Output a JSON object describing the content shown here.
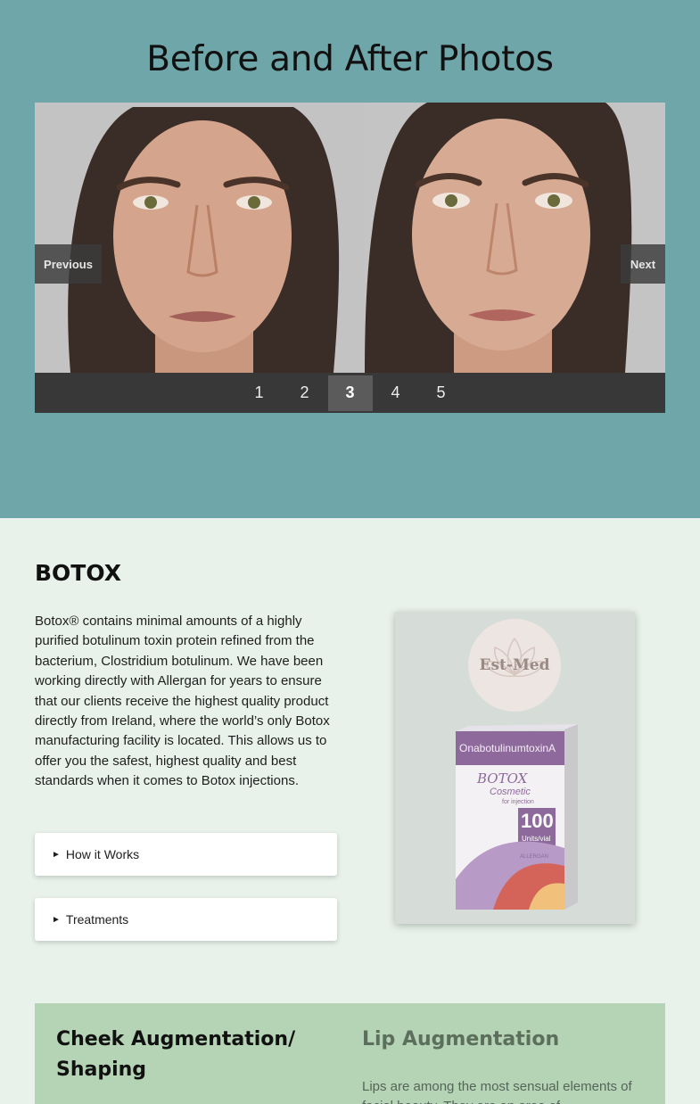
{
  "gallery": {
    "title": "Before and After Photos",
    "prev_label": "Previous",
    "next_label": "Next",
    "pages": [
      "1",
      "2",
      "3",
      "4",
      "5"
    ],
    "active_page": "3"
  },
  "botox": {
    "title": "BOTOX",
    "body": "Botox® contains minimal amounts of a highly purified botulinum toxin protein refined from the bacterium, Clostridium botulinum. We have been working directly with Allergan for years to ensure that our clients receive the highest quality product directly from Ireland, where the world’s only Botox manufacturing facility is located. This allows us to offer you the safest, highest quality and best standards when it comes to Botox injections.",
    "accordion": [
      {
        "label": "How it Works"
      },
      {
        "label": "Treatments"
      }
    ],
    "product": {
      "logo_text": "Est-Med",
      "box_line1": "OnabotulinumtoxinA",
      "box_brand": "BOTOX",
      "box_sub": "Cosmetic",
      "box_sub2": "for injection",
      "box_units": "100",
      "box_units_label": "Units/vial",
      "box_maker": "ALLERGAN"
    }
  },
  "services": {
    "title_1": "Cheek Augmentation/ Shaping",
    "title_2": "Lip Augmentation",
    "text_2": "Lips are among the most sensual elements of facial beauty. They are an area of..."
  },
  "colors": {
    "gallery_bg": "#6fa6aa",
    "page_bg": "#e8f2ea",
    "services_bg": "#b5d3b5",
    "pager_bg": "#383838"
  },
  "icons": {
    "accordion_arrow": "triangle-right-icon"
  }
}
